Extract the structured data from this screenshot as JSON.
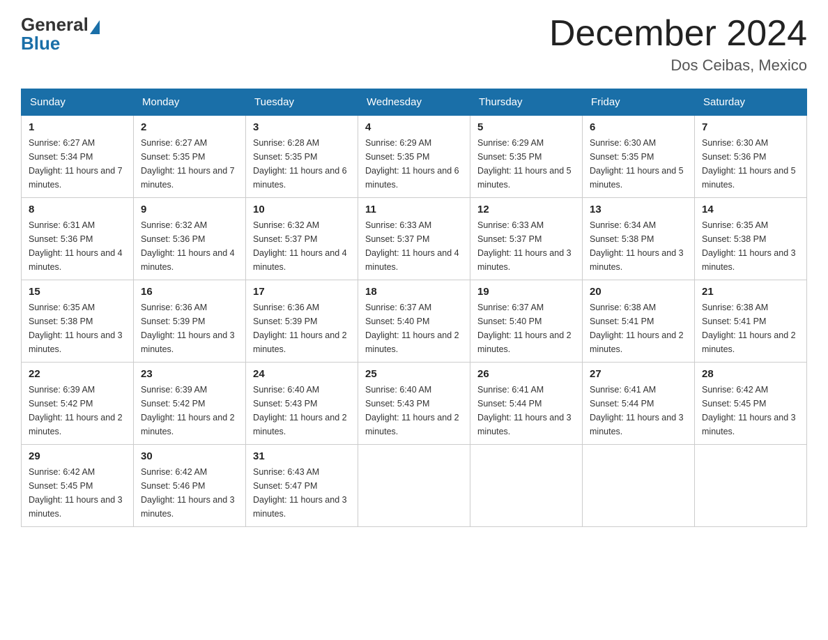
{
  "logo": {
    "general": "General",
    "blue": "Blue"
  },
  "title": "December 2024",
  "subtitle": "Dos Ceibas, Mexico",
  "days_of_week": [
    "Sunday",
    "Monday",
    "Tuesday",
    "Wednesday",
    "Thursday",
    "Friday",
    "Saturday"
  ],
  "weeks": [
    [
      {
        "day": "1",
        "sunrise": "6:27 AM",
        "sunset": "5:34 PM",
        "daylight": "11 hours and 7 minutes."
      },
      {
        "day": "2",
        "sunrise": "6:27 AM",
        "sunset": "5:35 PM",
        "daylight": "11 hours and 7 minutes."
      },
      {
        "day": "3",
        "sunrise": "6:28 AM",
        "sunset": "5:35 PM",
        "daylight": "11 hours and 6 minutes."
      },
      {
        "day": "4",
        "sunrise": "6:29 AM",
        "sunset": "5:35 PM",
        "daylight": "11 hours and 6 minutes."
      },
      {
        "day": "5",
        "sunrise": "6:29 AM",
        "sunset": "5:35 PM",
        "daylight": "11 hours and 5 minutes."
      },
      {
        "day": "6",
        "sunrise": "6:30 AM",
        "sunset": "5:35 PM",
        "daylight": "11 hours and 5 minutes."
      },
      {
        "day": "7",
        "sunrise": "6:30 AM",
        "sunset": "5:36 PM",
        "daylight": "11 hours and 5 minutes."
      }
    ],
    [
      {
        "day": "8",
        "sunrise": "6:31 AM",
        "sunset": "5:36 PM",
        "daylight": "11 hours and 4 minutes."
      },
      {
        "day": "9",
        "sunrise": "6:32 AM",
        "sunset": "5:36 PM",
        "daylight": "11 hours and 4 minutes."
      },
      {
        "day": "10",
        "sunrise": "6:32 AM",
        "sunset": "5:37 PM",
        "daylight": "11 hours and 4 minutes."
      },
      {
        "day": "11",
        "sunrise": "6:33 AM",
        "sunset": "5:37 PM",
        "daylight": "11 hours and 4 minutes."
      },
      {
        "day": "12",
        "sunrise": "6:33 AM",
        "sunset": "5:37 PM",
        "daylight": "11 hours and 3 minutes."
      },
      {
        "day": "13",
        "sunrise": "6:34 AM",
        "sunset": "5:38 PM",
        "daylight": "11 hours and 3 minutes."
      },
      {
        "day": "14",
        "sunrise": "6:35 AM",
        "sunset": "5:38 PM",
        "daylight": "11 hours and 3 minutes."
      }
    ],
    [
      {
        "day": "15",
        "sunrise": "6:35 AM",
        "sunset": "5:38 PM",
        "daylight": "11 hours and 3 minutes."
      },
      {
        "day": "16",
        "sunrise": "6:36 AM",
        "sunset": "5:39 PM",
        "daylight": "11 hours and 3 minutes."
      },
      {
        "day": "17",
        "sunrise": "6:36 AM",
        "sunset": "5:39 PM",
        "daylight": "11 hours and 2 minutes."
      },
      {
        "day": "18",
        "sunrise": "6:37 AM",
        "sunset": "5:40 PM",
        "daylight": "11 hours and 2 minutes."
      },
      {
        "day": "19",
        "sunrise": "6:37 AM",
        "sunset": "5:40 PM",
        "daylight": "11 hours and 2 minutes."
      },
      {
        "day": "20",
        "sunrise": "6:38 AM",
        "sunset": "5:41 PM",
        "daylight": "11 hours and 2 minutes."
      },
      {
        "day": "21",
        "sunrise": "6:38 AM",
        "sunset": "5:41 PM",
        "daylight": "11 hours and 2 minutes."
      }
    ],
    [
      {
        "day": "22",
        "sunrise": "6:39 AM",
        "sunset": "5:42 PM",
        "daylight": "11 hours and 2 minutes."
      },
      {
        "day": "23",
        "sunrise": "6:39 AM",
        "sunset": "5:42 PM",
        "daylight": "11 hours and 2 minutes."
      },
      {
        "day": "24",
        "sunrise": "6:40 AM",
        "sunset": "5:43 PM",
        "daylight": "11 hours and 2 minutes."
      },
      {
        "day": "25",
        "sunrise": "6:40 AM",
        "sunset": "5:43 PM",
        "daylight": "11 hours and 2 minutes."
      },
      {
        "day": "26",
        "sunrise": "6:41 AM",
        "sunset": "5:44 PM",
        "daylight": "11 hours and 3 minutes."
      },
      {
        "day": "27",
        "sunrise": "6:41 AM",
        "sunset": "5:44 PM",
        "daylight": "11 hours and 3 minutes."
      },
      {
        "day": "28",
        "sunrise": "6:42 AM",
        "sunset": "5:45 PM",
        "daylight": "11 hours and 3 minutes."
      }
    ],
    [
      {
        "day": "29",
        "sunrise": "6:42 AM",
        "sunset": "5:45 PM",
        "daylight": "11 hours and 3 minutes."
      },
      {
        "day": "30",
        "sunrise": "6:42 AM",
        "sunset": "5:46 PM",
        "daylight": "11 hours and 3 minutes."
      },
      {
        "day": "31",
        "sunrise": "6:43 AM",
        "sunset": "5:47 PM",
        "daylight": "11 hours and 3 minutes."
      },
      null,
      null,
      null,
      null
    ]
  ]
}
